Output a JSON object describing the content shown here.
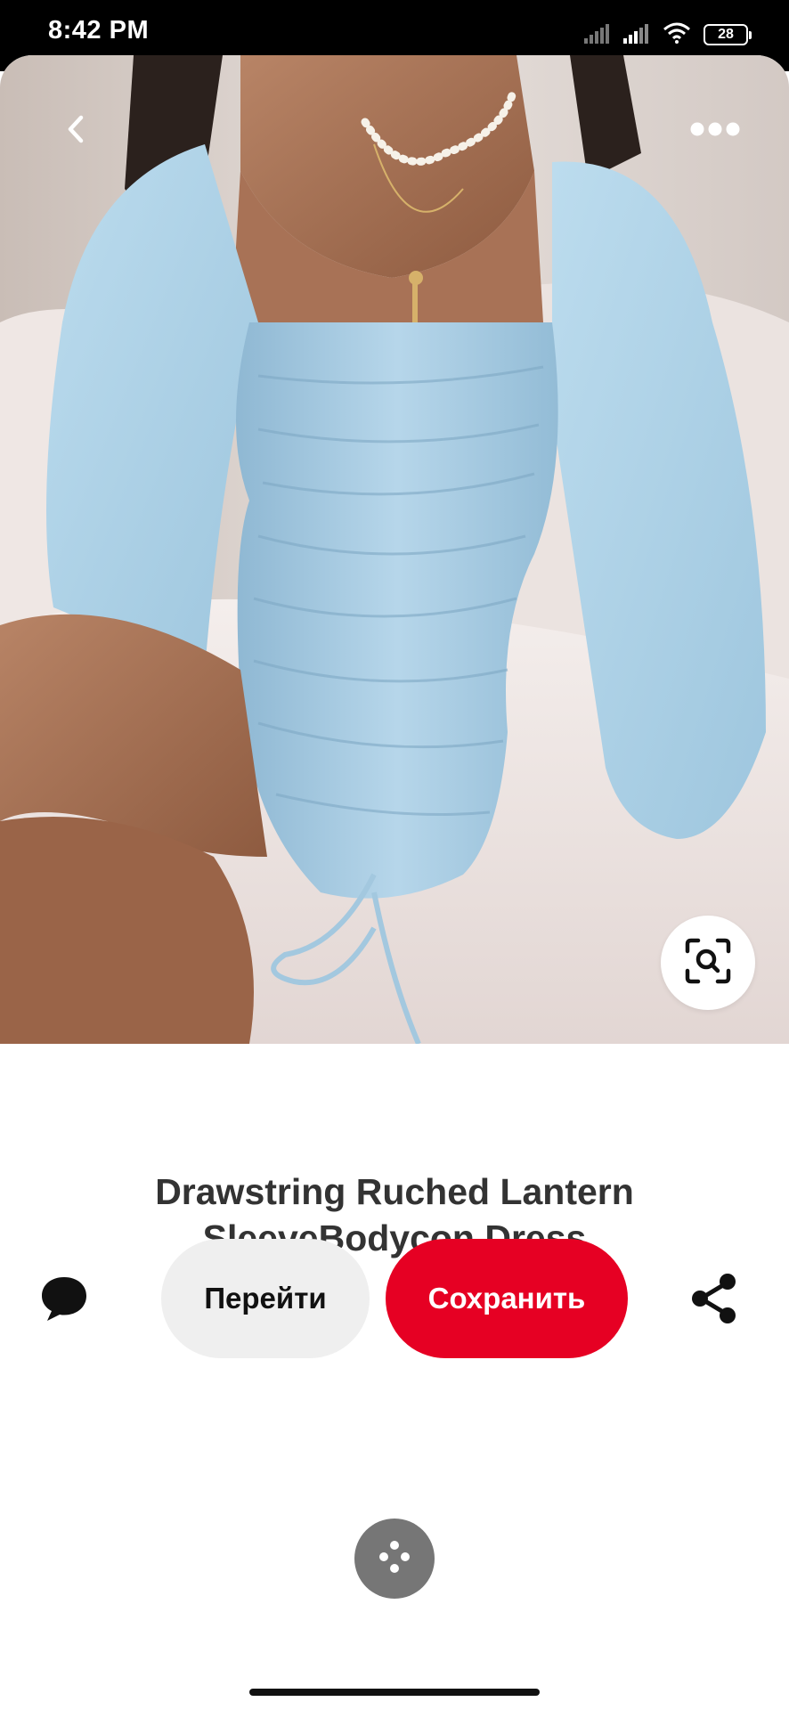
{
  "status_bar": {
    "time": "8:42 PM",
    "battery_level": "28",
    "icons": [
      "cell-signal-icon",
      "cell-signal-icon",
      "wifi-icon",
      "battery-icon"
    ]
  },
  "pin": {
    "title_line1": "Drawstring Ruched Lantern",
    "title_line2": "SleeveBodycon Dress",
    "image_subject": "light blue ruched bodycon dress with lantern sleeves"
  },
  "actions": {
    "visit_label": "Перейти",
    "save_label": "Сохранить"
  },
  "colors": {
    "save_red": "#e60023",
    "visit_gray": "#efefef",
    "dress_blue": "#a9cfe6"
  }
}
